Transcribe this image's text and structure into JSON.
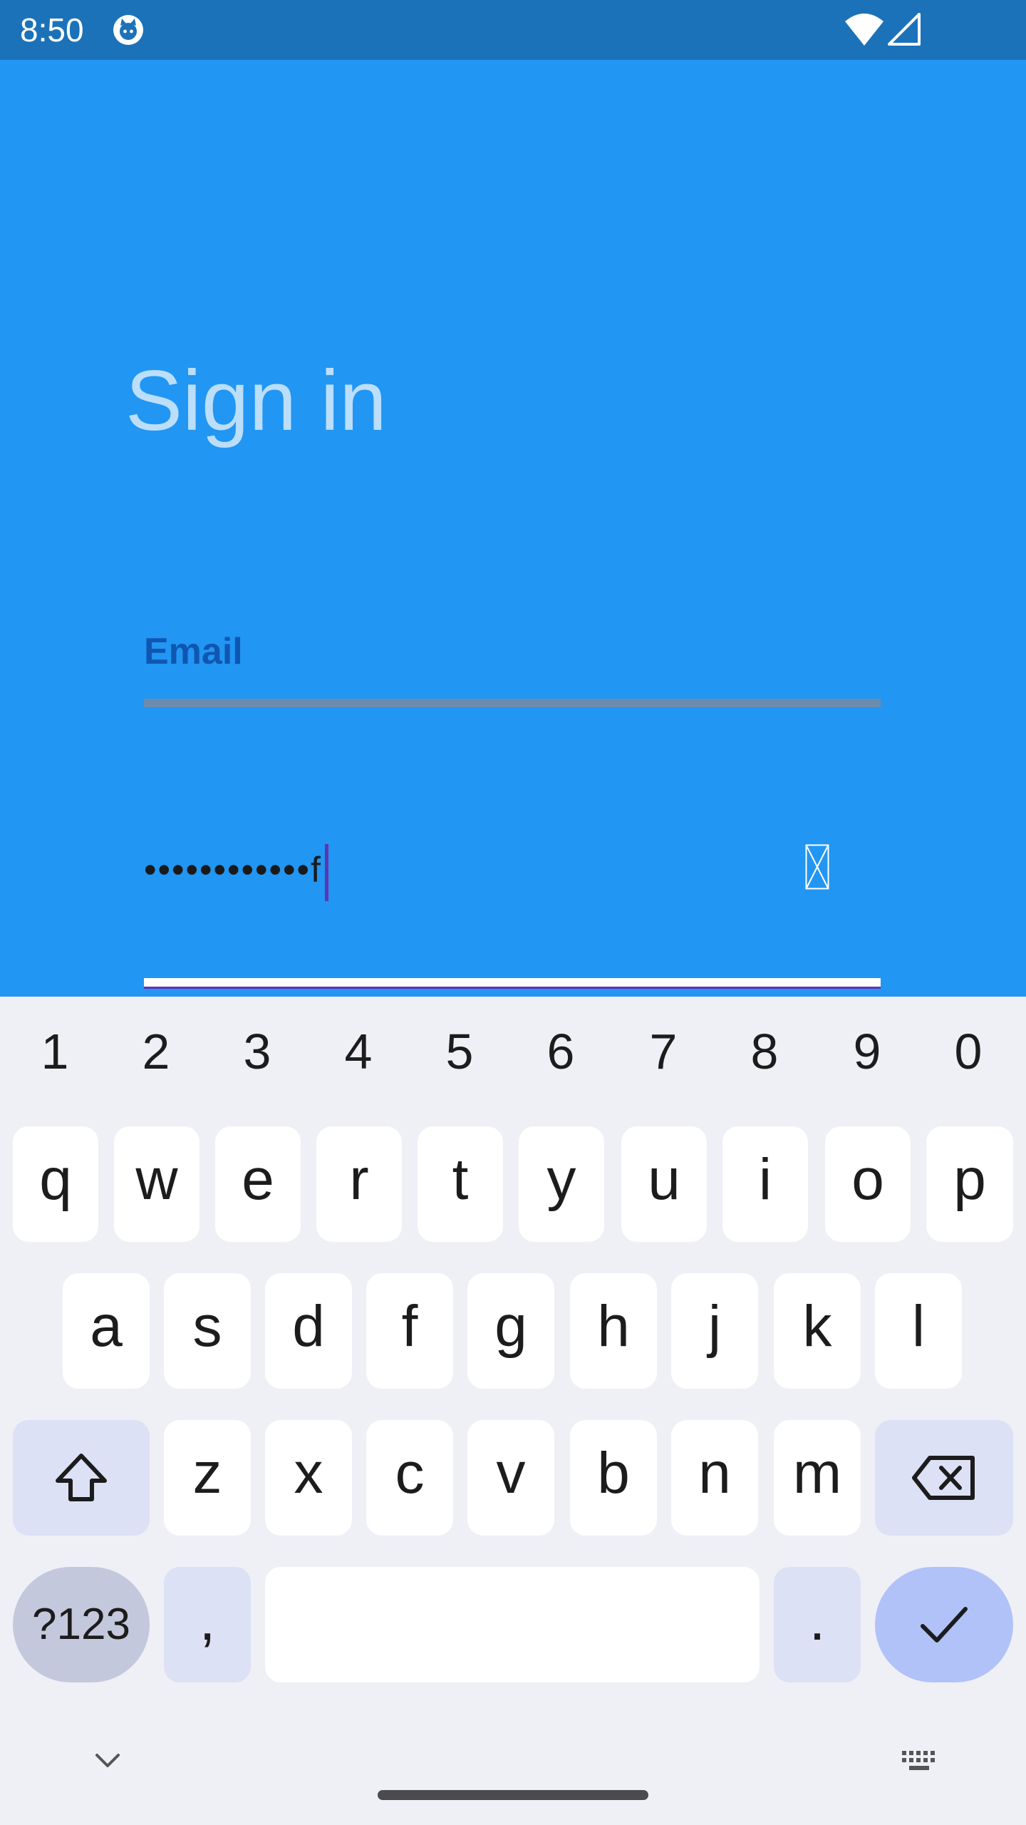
{
  "status_bar": {
    "time": "8:50"
  },
  "screen": {
    "title": "Sign in",
    "email": {
      "label": "Email"
    },
    "password": {
      "masked_value": "••••••••••••f"
    }
  },
  "colors": {
    "app_background": "#2196F3",
    "status_bar": "#1B72B8",
    "keyboard_background": "#EFEFF6",
    "accent": "#5E35B1"
  },
  "keyboard": {
    "numbers": [
      "1",
      "2",
      "3",
      "4",
      "5",
      "6",
      "7",
      "8",
      "9",
      "0"
    ],
    "row1": [
      "q",
      "w",
      "e",
      "r",
      "t",
      "y",
      "u",
      "i",
      "o",
      "p"
    ],
    "row2": [
      "a",
      "s",
      "d",
      "f",
      "g",
      "h",
      "j",
      "k",
      "l"
    ],
    "row3": [
      "z",
      "x",
      "c",
      "v",
      "b",
      "n",
      "m"
    ],
    "symbols_label": "?123",
    "comma": ",",
    "period": "."
  }
}
